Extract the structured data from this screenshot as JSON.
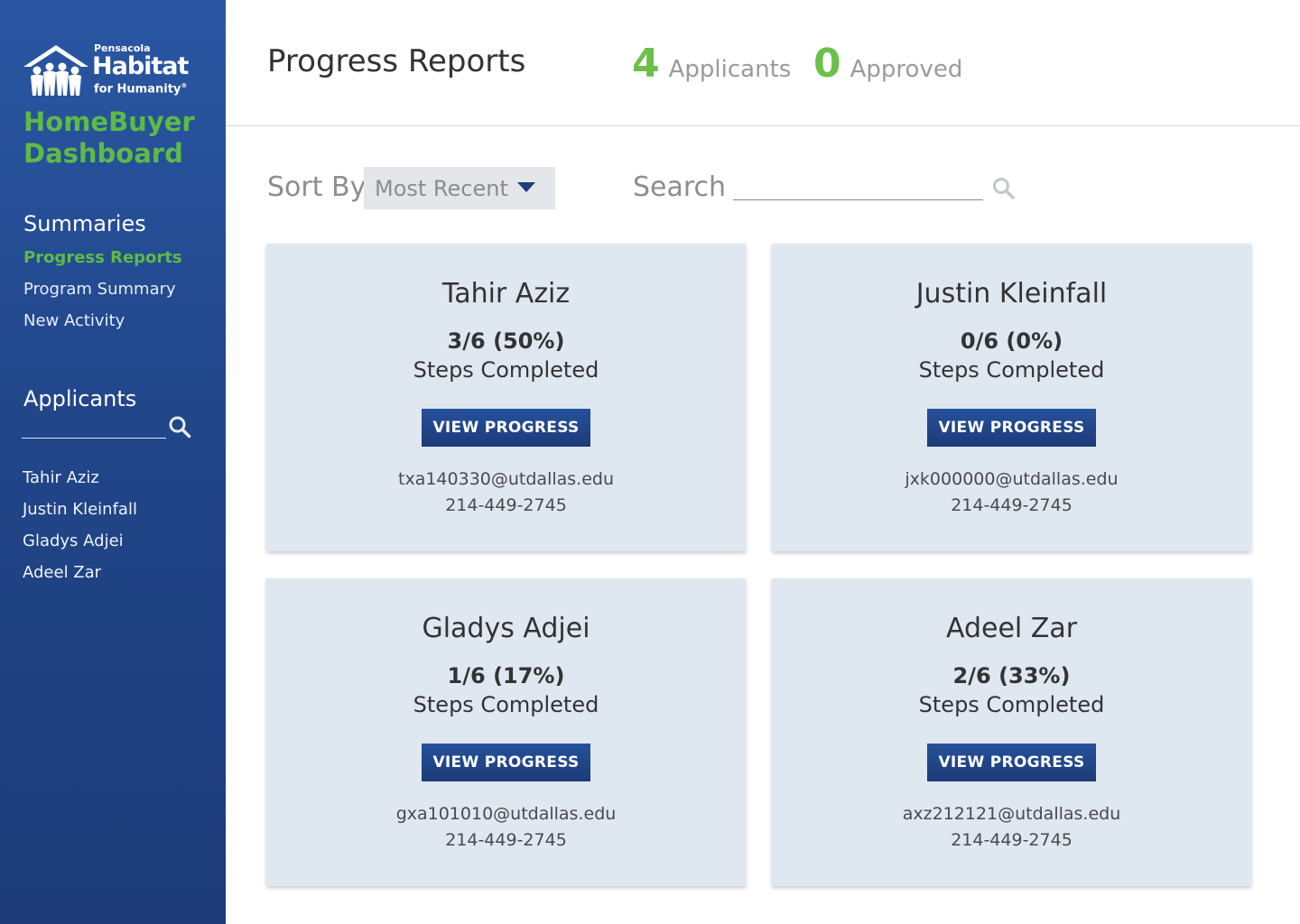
{
  "brand": {
    "pensacola": "Pensacola",
    "habitat": "Habitat",
    "for_humanity": "for Humanity",
    "registered": "®",
    "app_title_line1": "HomeBuyer",
    "app_title_line2": "Dashboard"
  },
  "sidebar": {
    "summaries_heading": "Summaries",
    "summaries": [
      {
        "label": "Progress Reports",
        "active": true
      },
      {
        "label": "Program Summary",
        "active": false
      },
      {
        "label": "New Activity",
        "active": false
      }
    ],
    "applicants_heading": "Applicants",
    "applicants": [
      "Tahir Aziz",
      "Justin Kleinfall",
      "Gladys Adjei",
      "Adeel Zar"
    ]
  },
  "header": {
    "title": "Progress Reports",
    "applicants_count": "4",
    "applicants_label": "Applicants",
    "approved_count": "0",
    "approved_label": "Approved"
  },
  "controls": {
    "sort_label": "Sort By",
    "sort_value": "Most Recent",
    "search_label": "Search",
    "search_value": ""
  },
  "cards": [
    {
      "name": "Tahir Aziz",
      "steps": "3/6 (50%)",
      "steps_label": "Steps Completed",
      "button": "VIEW PROGRESS",
      "email": "txa140330@utdallas.edu",
      "phone": "214-449-2745"
    },
    {
      "name": "Justin Kleinfall",
      "steps": "0/6 (0%)",
      "steps_label": "Steps Completed",
      "button": "VIEW PROGRESS",
      "email": "jxk000000@utdallas.edu",
      "phone": "214-449-2745"
    },
    {
      "name": "Gladys Adjei",
      "steps": "1/6 (17%)",
      "steps_label": "Steps Completed",
      "button": "VIEW PROGRESS",
      "email": "gxa101010@utdallas.edu",
      "phone": "214-449-2745"
    },
    {
      "name": "Adeel Zar",
      "steps": "2/6 (33%)",
      "steps_label": "Steps Completed",
      "button": "VIEW PROGRESS",
      "email": "axz212121@utdallas.edu",
      "phone": "214-449-2745"
    }
  ],
  "colors": {
    "sidebar_blue": "#21468a",
    "accent_green": "#5dbb46",
    "button_blue": "#1c3b78",
    "card_bg": "#dfe7f1"
  },
  "icons": {
    "logo": "habitat-house-logo",
    "search": "search-icon",
    "sort_caret": "caret-down-icon"
  }
}
